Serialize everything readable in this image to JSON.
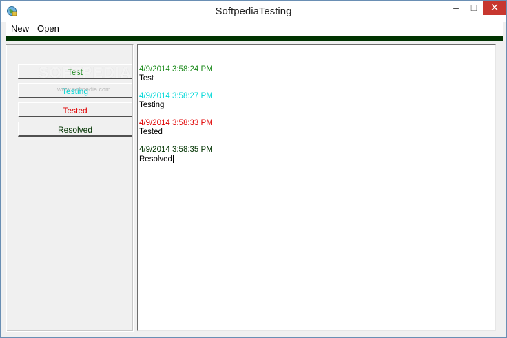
{
  "window": {
    "title": "SoftpediaTesting"
  },
  "menu": {
    "items": [
      "New",
      "Open"
    ]
  },
  "buttons": [
    {
      "label": "Test",
      "color": "#1a8a1a"
    },
    {
      "label": "Testing",
      "color": "#00d8d8"
    },
    {
      "label": "Tested",
      "color": "#e00000"
    },
    {
      "label": "Resolved",
      "color": "#003300"
    }
  ],
  "watermark": {
    "main": "SOFTPEDIA",
    "sub": "www.softpedia.com"
  },
  "log": [
    {
      "timestamp": "4/9/2014 3:58:24 PM",
      "message": "Test",
      "color": "#1a8a1a"
    },
    {
      "timestamp": "4/9/2014 3:58:27 PM",
      "message": "Testing",
      "color": "#00d8d8"
    },
    {
      "timestamp": "4/9/2014 3:58:33 PM",
      "message": "Tested",
      "color": "#e00000"
    },
    {
      "timestamp": "4/9/2014 3:58:35 PM",
      "message": "Resolved",
      "color": "#003300"
    }
  ],
  "colors": {
    "accent_bar": "#003300",
    "close_button": "#c7372f"
  },
  "icons": {
    "app": "app-globe-icon",
    "minimize": "minimize-icon",
    "maximize": "maximize-icon",
    "close": "close-icon"
  }
}
